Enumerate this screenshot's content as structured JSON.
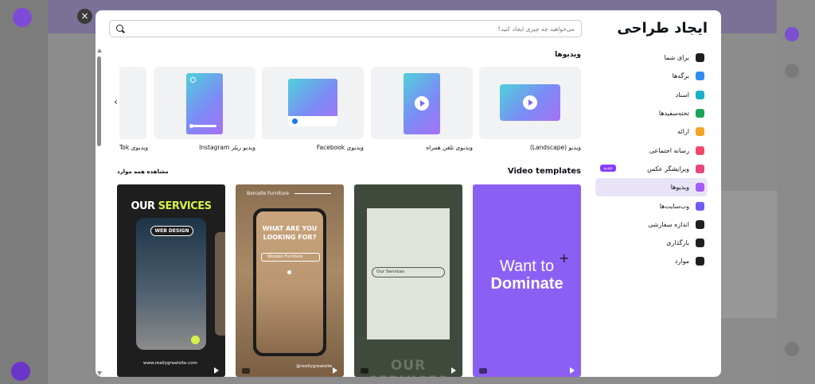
{
  "modal": {
    "title": "ایجاد طراحی",
    "close_symbol": "×",
    "search": {
      "placeholder": "می‌خواهید چه چیزی ایجاد کنید؟"
    }
  },
  "sidebar": {
    "items": [
      {
        "label": "برای شما",
        "icon": "sparkle-icon",
        "color": "#1f1f1f"
      },
      {
        "label": "برگه‌ها",
        "icon": "sheets-icon",
        "color": "#2f8bf0"
      },
      {
        "label": "اسناد",
        "icon": "docs-icon",
        "color": "#1bb0c7"
      },
      {
        "label": "تخته‌سفیدها",
        "icon": "whiteboard-icon",
        "color": "#1aa45a"
      },
      {
        "label": "ارائه",
        "icon": "presentation-icon",
        "color": "#f5a524"
      },
      {
        "label": "رسانه اجتماعی",
        "icon": "social-heart-icon",
        "color": "#ef4868"
      },
      {
        "label": "ویرایشگر عکس",
        "icon": "photo-editor-icon",
        "color": "#e8457f",
        "badge": "جدید"
      },
      {
        "label": "ویدیوها",
        "icon": "video-icon",
        "color": "#a35cf5",
        "active": true
      },
      {
        "label": "وب‌سایت‌ها",
        "icon": "website-icon",
        "color": "#6f5cf5"
      },
      {
        "label": "اندازه سفارشی",
        "icon": "custom-size-icon",
        "color": "#1f1f1f"
      },
      {
        "label": "بارگذاری",
        "icon": "upload-icon",
        "color": "#1f1f1f"
      },
      {
        "label": "موارد",
        "icon": "more-icon",
        "color": "#1f1f1f"
      }
    ]
  },
  "videos": {
    "title": "ویدیوها",
    "cards": [
      {
        "label": "ویدیو (Landscape)"
      },
      {
        "label": "ویدیوی تلفن همراه"
      },
      {
        "label": "ویدیوی Facebook"
      },
      {
        "label": "ویدیو ریلز Instagram"
      },
      {
        "label": "ویدیوی Tok"
      }
    ]
  },
  "templates": {
    "title": "Video templates",
    "see_all": "مشاهده همه موارد",
    "items": [
      {
        "line1": "Want to",
        "line2": "Dominate"
      },
      {
        "search_text": "Our Services",
        "bottom_text": "OUR SERVICES"
      },
      {
        "header": "Borcelle Furniture",
        "headline": "WHAT ARE YOU LOOKING FOR?",
        "search_text": "Wooden Furniture",
        "footer": "@reallygreatsite"
      },
      {
        "headline_a": "OUR",
        "headline_b": "SERVICES",
        "tag": "WEB DESIGN",
        "footer": "www.reallygreatsite.com"
      }
    ]
  }
}
